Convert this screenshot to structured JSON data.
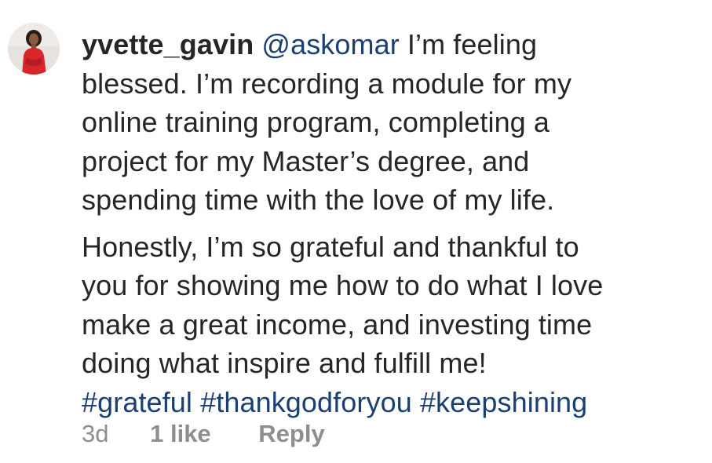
{
  "comment": {
    "username": "yvette_gavin",
    "mention": "@askomar",
    "lines": [
      " I’m feeling",
      "blessed. I’m recording a module for my",
      "online training program, completing a",
      "project for my Master’s degree, and",
      "spending time with the love of my life.",
      "Honestly, I’m so grateful and thankful to",
      "you for showing me how to do what I love",
      "make a great income, and investing time",
      "doing what inspire and fulfill me!"
    ],
    "hashtags": [
      "#grateful",
      "#thankgodforyou",
      "#keepshining"
    ],
    "time": "3d",
    "likes": "1 like",
    "reply": "Reply"
  },
  "colors": {
    "text": "#262626",
    "link": "#1b3f73",
    "meta": "#8e8e8e",
    "avatar_dress": "#d8262b"
  }
}
